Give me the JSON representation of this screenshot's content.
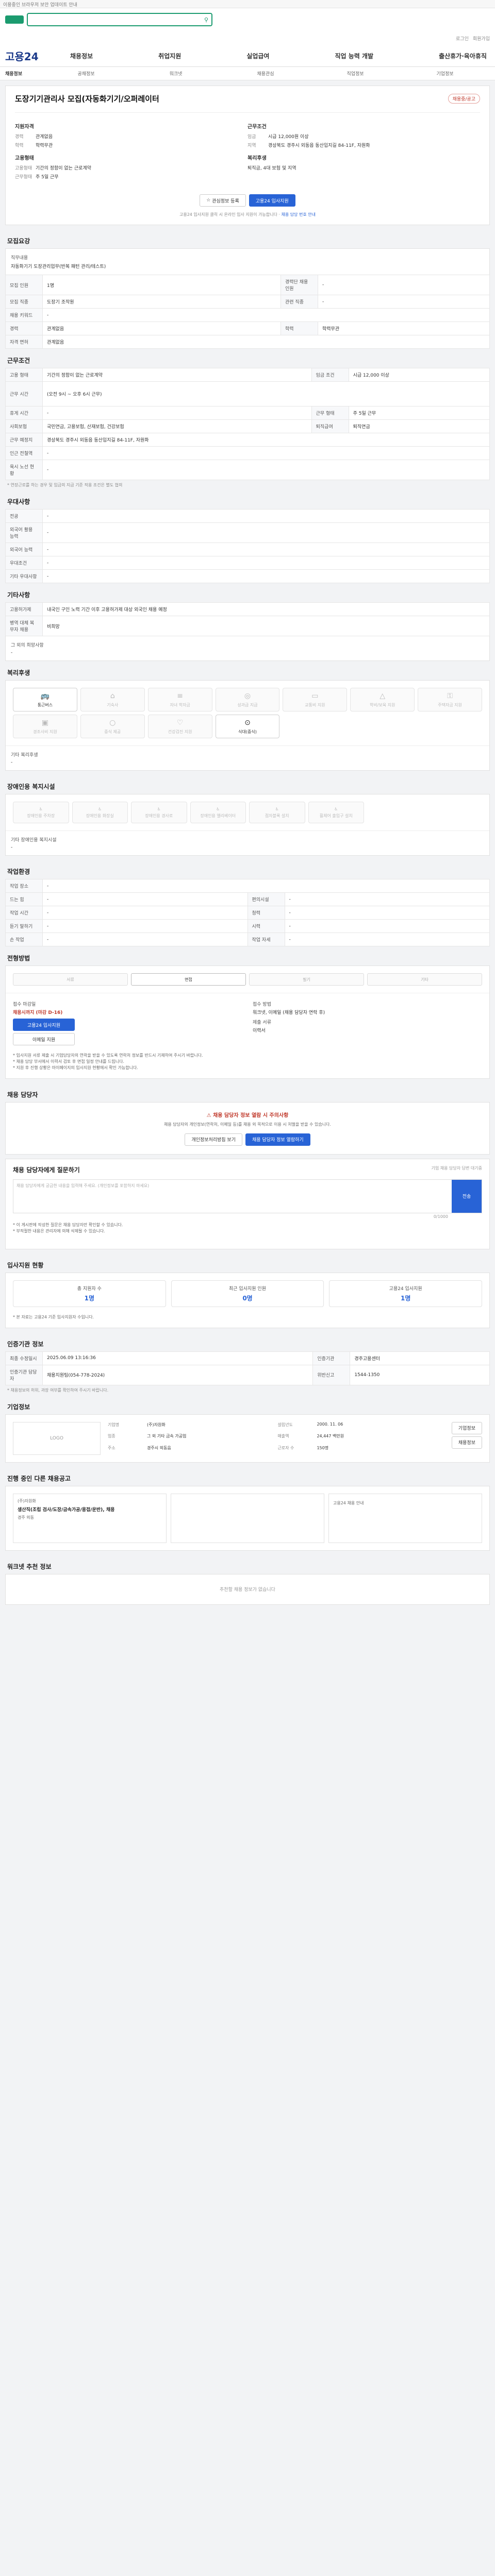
{
  "topbar": {
    "notice": "이용중인 브라우저 보안 업데이트 안내"
  },
  "util": {
    "links": [
      "로그인",
      "회원가입"
    ]
  },
  "gnb": {
    "brand": "고용24",
    "menu": [
      "채용정보",
      "취업지원",
      "실업급여",
      "직업 능력 개발",
      "출산휴가·육아휴직"
    ]
  },
  "lnb": {
    "items": [
      "채용정보",
      "공채정보",
      "워크넷",
      "채용관심",
      "직업정보",
      "기업정보"
    ]
  },
  "job": {
    "title": "도장기기관리사 모집(자동화기기/오퍼레이터",
    "badge": "채용중/공고",
    "company_h": "지원자격",
    "company_rows": [
      [
        "경력",
        "관계없음"
      ],
      [
        "학력",
        "학력무관"
      ]
    ],
    "cond_h": "근무조건",
    "cond_rows": [
      [
        "임금",
        "시급 12,000원 이상"
      ],
      [
        "지역",
        "경상북도 경주시 외동읍 동산입지길 84-11F, 자원화"
      ]
    ],
    "form_h": "고용형태",
    "form_rows": [
      [
        "고용형태",
        "기간의 정함이 없는 근로계약"
      ],
      [
        "근무형태",
        "주 5일 근무"
      ]
    ],
    "welfare_h": "복리후생",
    "welfare_val": "퇴직금, 4대 보험 및 지역",
    "btn_scrap": "관심정보 등록",
    "btn_apply": "고용24 입사지원",
    "notice": "고용24 입사지원 클릭 시 온라인 입사 지원이 가능합니다",
    "notice_link": "채용 담당 번호 안내"
  },
  "recruit": {
    "title": "모집요강",
    "duty_k": "직무내용",
    "duty_v": "자동화기기 도장관리업무(반복 패턴 관리/테스트)",
    "rows": [
      [
        "모집 인원",
        "1명",
        "경력단 채용 인원",
        "-"
      ],
      [
        "모집 직종",
        "도장기 조작원",
        "관련 직종",
        "-"
      ],
      [
        "채용 키워드",
        "-",
        "",
        ""
      ],
      [
        "경력",
        "관계없음",
        "학력",
        "학력무관"
      ],
      [
        "자격 면허",
        "관계없음",
        "",
        ""
      ]
    ]
  },
  "work": {
    "title": "근무조건",
    "rows": [
      [
        "고용 형태",
        "기간의 정함이 없는 근로계약",
        "임금 조건",
        "시급 12,000 이상"
      ],
      [
        "근무 시간",
        "(오전 9시 ~ 오후 6시 근무)",
        "",
        ""
      ],
      [
        "휴게 시간",
        "-",
        "근무 형태",
        "주 5일 근무"
      ],
      [
        "사회보험",
        "국민연금, 고용보험, 산재보험, 건강보험",
        "퇴직급여",
        "퇴직연금"
      ],
      [
        "근무 예정지",
        "경상북도 경주시 외동읍 동산입지길 84-11F, 자원화",
        "",
        ""
      ],
      [
        "인근 전철역",
        "-",
        "",
        ""
      ],
      [
        "육시 노선 현황",
        "-",
        "",
        ""
      ]
    ],
    "note": "* 연장근로를 하는 경우 및 임금의 지급 기준 적용 조건은 별도 협의"
  },
  "pref": {
    "title": "우대사항",
    "rows": [
      [
        "전공",
        "-"
      ],
      [
        "외국어 활용 능력",
        "-"
      ],
      [
        "외국어 능력",
        "-"
      ],
      [
        "우대조건",
        "-"
      ],
      [
        "기타 우대사항",
        "-"
      ]
    ]
  },
  "etc": {
    "title": "기타사항",
    "rows": [
      [
        "고용허가제",
        "내국인 구인 노력 기간 이후 고용허가제 대상 외국인 채용 예정"
      ],
      [
        "병역 대체 복무자 채용",
        "비희망"
      ]
    ],
    "etc_k": "그 외의 희망사항",
    "etc_v": "-"
  },
  "welfare": {
    "title": "복리후생",
    "items": [
      {
        "label": "통근버스",
        "on": true,
        "icon": "bus-icon"
      },
      {
        "label": "기숙사",
        "on": false,
        "icon": "house-icon"
      },
      {
        "label": "자녀 학자금",
        "on": false,
        "icon": "book-icon"
      },
      {
        "label": "성과급 지급",
        "on": false,
        "icon": "coin-icon"
      },
      {
        "label": "교통비 지원",
        "on": false,
        "icon": "ticket-icon"
      },
      {
        "label": "학비/보육 지원",
        "on": false,
        "icon": "cap-icon"
      },
      {
        "label": "주택자금 지원",
        "on": false,
        "icon": "key-icon"
      },
      {
        "label": "경조사비 지원",
        "on": false,
        "icon": "gift-icon"
      },
      {
        "label": "중식 제공",
        "on": false,
        "icon": "meal-icon"
      },
      {
        "label": "건강검진 지원",
        "on": false,
        "icon": "heart-icon"
      },
      {
        "label": "식대(중식)",
        "on": true,
        "icon": "spoon-icon"
      }
    ],
    "etc_k": "기타 복리후생",
    "etc_v": "-"
  },
  "disab": {
    "title": "장애인용 복지시설",
    "items": [
      "장애인용 주차장",
      "장애인용 화장실",
      "장애인용 경사로",
      "장애인용 엘리베이터",
      "점자블록 설치",
      "휠체어 출입구 설치"
    ],
    "etc_k": "기타 장애인용 복지시설",
    "etc_v": "-"
  },
  "env": {
    "title": "작업환경",
    "rows": [
      [
        "작업 장소",
        "-",
        "",
        ""
      ],
      [
        "드는 힘",
        "-",
        "편의시설",
        "-"
      ],
      [
        "작업 시간",
        "-",
        "청력",
        "-"
      ],
      [
        "듣기 말하기",
        "-",
        "시력",
        "-"
      ],
      [
        "손 작업",
        "-",
        "작업 자세",
        "-"
      ]
    ]
  },
  "process": {
    "title": "전형방법",
    "steps": [
      {
        "label": "서류",
        "on": false
      },
      {
        "label": "면접",
        "on": true
      },
      {
        "label": "필기",
        "on": false
      },
      {
        "label": "기타",
        "on": false
      }
    ],
    "recv_k": "접수 마감일",
    "recv_v": "채용시까지 (마감 D-16)",
    "apply_btn": "고용24 입사지원",
    "email_btn": "이메일 지원",
    "method_k": "접수 방법",
    "method_v": "워크넷, 이메일 (채용 담당자 연락 후)",
    "docs_k": "제출 서류",
    "docs_v": "이력서",
    "bullets": [
      "* 입사지원 서류 제출 시 기업담당자의 연락을 받을 수 있도록 연락처 정보를 반드시 기재하여 주시기 바랍니다.",
      "* 채용 담당 부서에서 이력서 검토 후 면접 일정 안내를 드립니다.",
      "* 지원 후 진행 상황은 마이페이지의 입사지원 현황에서 확인 가능합니다."
    ]
  },
  "manager": {
    "title": "채용 담당자",
    "warn": "채용 담당자 정보 열람 시 주의사항",
    "p": "채용 담당자의 개인정보(연락처, 이메일 등)를 채용 외 목적으로 이용 시 처벌을 받을 수 있습니다.",
    "btn_view": "개인정보처리방침 보기",
    "btn_show": "채용 담당자 정보 열람하기"
  },
  "question": {
    "title": "채용 담당자에게 질문하기",
    "placeholder": "채용 담당자에게 궁금한 내용을 입력해 주세요. (개인정보를 포함하지 마세요)",
    "count": "0/1000",
    "send": "전송",
    "side": "기업 채용 담당자 답변 대기중",
    "bullets": [
      "* 이 게시판에 작성한 질문은 채용 담당자만 확인할 수 있습니다.",
      "* 부적절한 내용은 관리자에 의해 삭제될 수 있습니다."
    ]
  },
  "stats": {
    "title": "입사지원 현황",
    "items": [
      [
        "총 지원자 수",
        "1명"
      ],
      [
        "최근 입사지원 인원",
        "0명"
      ],
      [
        "고용24 입사지원",
        "1명"
      ]
    ],
    "note": "* 본 자료는 고용24 기준 입사지원자 수입니다."
  },
  "info": {
    "title": "인증기관 정보",
    "rows": [
      [
        "최종 수정일시",
        "2025.06.09 13:16:36",
        "인증기관",
        "경주고용센터"
      ],
      [
        "인증기관 담당자",
        "채용지원팀(054-778-2024)",
        "위반신고",
        "1544-1350"
      ]
    ],
    "note": "* 채용정보의 허위, 과장 여부를 확인하여 주시기 바랍니다."
  },
  "company": {
    "title": "기업정보",
    "logo": "LOGO",
    "rows": [
      [
        "기업명",
        "(주)자원화",
        "설립년도",
        "2000. 11. 06"
      ],
      [
        "업종",
        "그 외 기타 금속 가공업",
        "매출액",
        "24,447 백만원"
      ],
      [
        "주소",
        "경주시 외동읍",
        "근로자 수",
        "150명"
      ]
    ],
    "btn_a": "기업정보",
    "btn_b": "채용정보"
  },
  "related": {
    "title": "진행 중인 다른 채용공고",
    "cards": [
      {
        "co": "(주)자원화",
        "title": "생산직(조립 검사/도장/금속가공/용접/운반), 채용",
        "meta": "경주 외동"
      },
      {
        "co": "",
        "title": "",
        "meta": ""
      },
      {
        "co": "",
        "title": "",
        "meta": "고용24 채용 안내"
      }
    ],
    "empty_title": "워크넷 추천 정보",
    "empty": "추천할 채용 정보가 없습니다"
  }
}
